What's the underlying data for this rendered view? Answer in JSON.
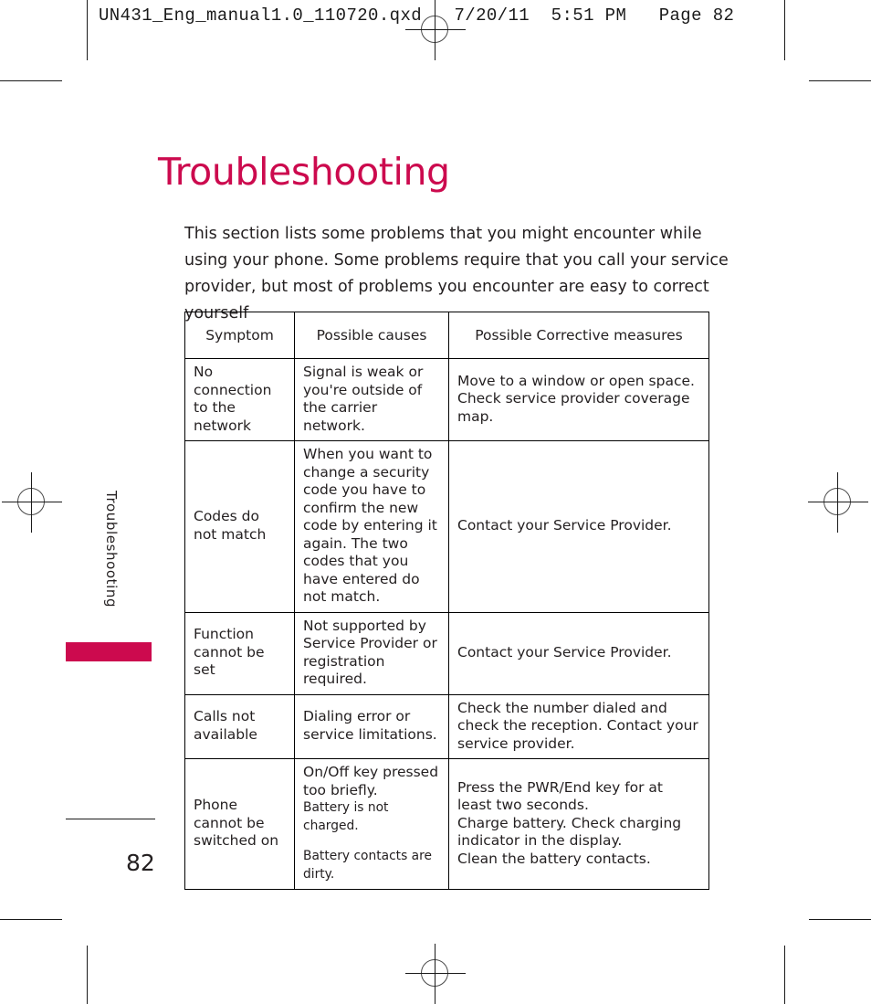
{
  "slug": {
    "text": "UN431_Eng_manual1.0_110720.qxd   7/20/11  5:51 PM   Page 82"
  },
  "page": {
    "title": "Troubleshooting",
    "title_color": "#cc0a4e",
    "intro": "This section lists some problems that you might encounter while using your phone. Some problems require that you call your service provider, but most of problems you encounter are easy to correct yourself",
    "side_tab_label": "Troubleshooting",
    "side_tab_color": "#cc0a4e",
    "page_number": "82"
  },
  "table": {
    "headers": [
      "Symptom",
      "Possible causes",
      "Possible Corrective measures"
    ],
    "rows": [
      {
        "symptom": "No connection to the network",
        "cause": "Signal is weak or you're outside of the carrier network.",
        "fix": "Move to a window or open space. Check service provider coverage map."
      },
      {
        "symptom": "Codes do not match",
        "cause": "When you want to change a security code you have to confirm the new code by entering it again. The two codes that you have entered do not match.",
        "fix": "Contact your Service Provider."
      },
      {
        "symptom": "Function cannot be set",
        "cause": "Not supported by Service Provider or registration required.",
        "fix": "Contact your Service Provider."
      },
      {
        "symptom": "Calls not available",
        "cause": "Dialing error or service limitations.",
        "fix": "Check the number dialed and check the reception. Contact your service provider."
      },
      {
        "symptom": "Phone cannot be switched on",
        "cause_line1": "On/Off key pressed too briefly.",
        "cause_line2": "Battery is not charged.",
        "cause_line3": "Battery contacts are dirty.",
        "fix_line1": "Press the PWR/End key for at least two seconds.",
        "fix_line2": "Charge battery. Check charging indicator in the display.",
        "fix_line3": "Clean the battery contacts."
      }
    ]
  }
}
